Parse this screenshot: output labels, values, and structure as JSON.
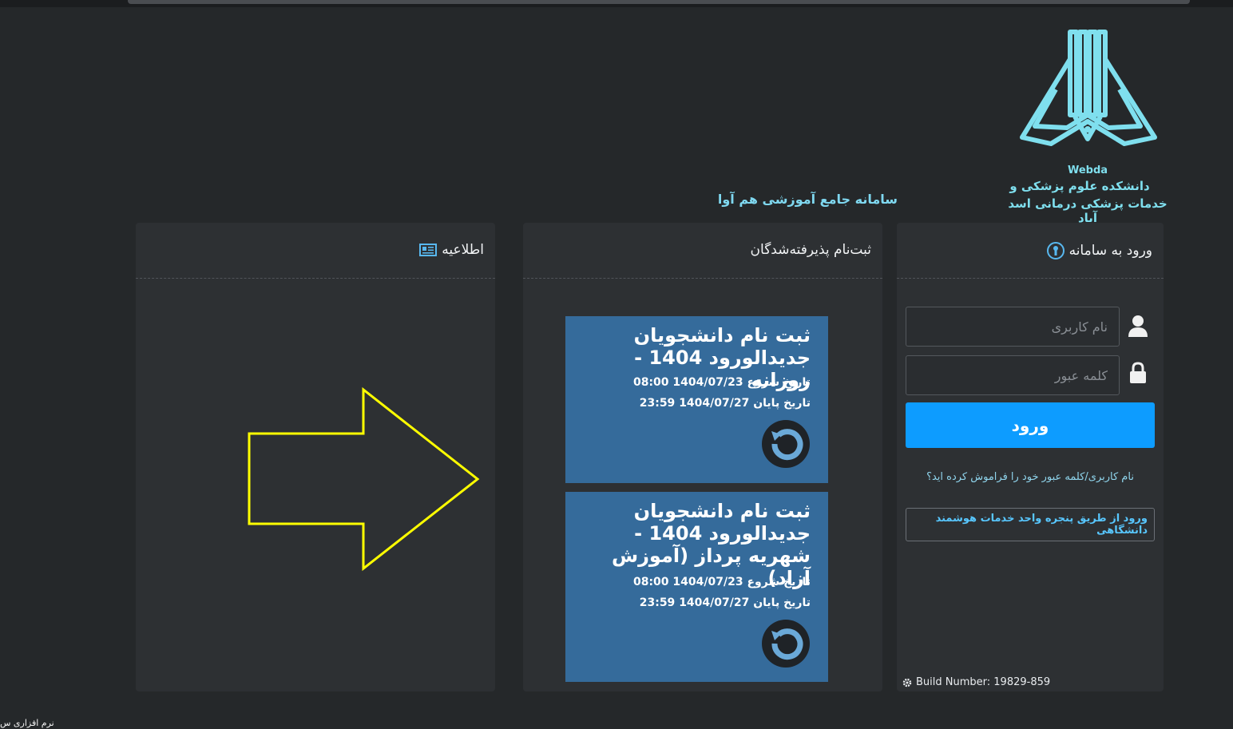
{
  "logo": {
    "brand": "Webda",
    "line1": "دانشکده علوم پزشکی و",
    "line2": "خدمات پزشکی درمانی اسد آباد"
  },
  "system_title": "سامانه جامع آموزشی هم آوا",
  "login": {
    "title": "ورود به سامانه",
    "username_placeholder": "نام کاربری",
    "password_placeholder": "کلمه عبور",
    "submit_label": "ورود",
    "forgot_link": "نام کاربری/کلمه عبور خود را فراموش کرده اید؟",
    "sso_label": "ورود از طریق پنجره واحد خدمات هوشمند دانشگاهی",
    "build": "Build Number: 19829-859"
  },
  "register": {
    "title": "ثبت‌نام پذیرفته‌شدگان",
    "cards": [
      {
        "title": "ثبت نام دانشجویان جدیدالورود 1404 - روزانه",
        "start": "تاریخ شروع 1404/07/23 08:00",
        "end": "تاریخ پایان 1404/07/27 23:59"
      },
      {
        "title": "ثبت نام دانشجویان جدیدالورود 1404 - شهریه پرداز (آموزش آزاد)",
        "start": "تاریخ شروع 1404/07/23 08:00",
        "end": "تاریخ پایان 1404/07/27 23:59"
      }
    ]
  },
  "news": {
    "title": "اطلاعیه"
  },
  "footer": {
    "text": "نرم افزاری س"
  },
  "colors": {
    "background": "#25282a",
    "panel": "#2d3033",
    "accent": "#0d9cff",
    "card": "#356b9b",
    "logo": "#7fdfee",
    "arrow": "#ffff00"
  },
  "icons": {
    "login_title": "keyhole-icon",
    "username": "user-icon",
    "password": "lock-icon",
    "news_title": "newspaper-icon",
    "card": "history-icon",
    "build": "gear-icon"
  }
}
